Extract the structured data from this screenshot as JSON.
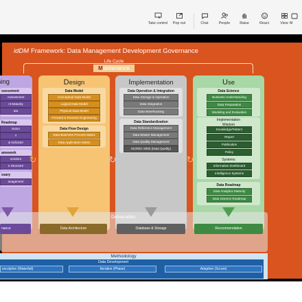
{
  "toolbar": {
    "buttons": [
      {
        "label": "Take control",
        "icon": "take-control-icon"
      },
      {
        "label": "Pop out",
        "icon": "pop-out-icon"
      },
      {
        "label": "Chat",
        "icon": "chat-icon"
      },
      {
        "label": "People",
        "icon": "people-icon"
      },
      {
        "label": "Raise",
        "icon": "raise-hand-icon"
      },
      {
        "label": "React",
        "icon": "react-icon"
      },
      {
        "label": "View",
        "icon": "view-icon"
      },
      {
        "label": "M",
        "icon": "more-icon"
      }
    ]
  },
  "slide": {
    "brand": "idDM",
    "title": "Framework: Data Management Development Governance",
    "lifecycle": "Life Cycle",
    "maintenance_cap": "M",
    "maintenance_rest": "aintenance",
    "columns": {
      "planning": {
        "title_rest": "ning",
        "boxes": [
          "ssessment",
          "Assessment",
          "nt Maturity",
          "ata",
          "Roadmap",
          "ission",
          "Y",
          "& Indicator",
          "amework",
          "ocedure",
          "e Structure",
          "ssary",
          "anagement"
        ]
      },
      "design": {
        "title_cap": "D",
        "title_rest": "esign",
        "model_heading": "Data Model",
        "model_boxes": [
          "Conceptual Data Model",
          "Logical Data Model",
          "Physical Data Model",
          "Forward & Reverse Engineering"
        ],
        "flow_heading": "Data Flow Design",
        "flow_boxes": [
          "Data Business Process Matrix",
          "Data Application Matrix"
        ]
      },
      "implementation": {
        "title_cap": "I",
        "title_rest": "mplementation",
        "ops_heading": "Data Operation & Integration",
        "ops_boxes": [
          "Data Storage & Operation",
          "Data Integration",
          "Data Warehousing"
        ],
        "std_heading": "Data Standardization",
        "std_boxes": [
          "Data Reference Management",
          "Data Master Management",
          "Data Quality Management",
          "ISO/IEC 8000 (Data Quality)"
        ]
      },
      "use": {
        "title_cap": "U",
        "title_rest": "se",
        "science_heading": "Data Science",
        "science_boxes": [
          "Business Understanding",
          "Data Preparation",
          "Modeling and Evaluation"
        ],
        "impl_heading": "Implementation",
        "wisdom_heading": "Wisdom",
        "wisdom_boxes": [
          "Knowledge/Pattern",
          "Report",
          "Publication",
          "Policy"
        ],
        "systems_heading": "Systems",
        "systems_boxes": [
          "Information Dashboard",
          "Intelligence Systems"
        ],
        "roadmap_heading": "Data Roadmap",
        "roadmap_boxes": [
          "Data Analytics Maturity",
          "Data Science Roadmap"
        ]
      }
    },
    "deliverables": {
      "label": "Deliverables",
      "items": [
        "nance",
        "Data Architecture",
        "Database & Storage",
        "Recommendation"
      ]
    },
    "methodology": {
      "label": "Methodology",
      "dev": "Data Development",
      "options": [
        "escriptive (Waterfall)",
        "Iterative (Phase)",
        "Adaptive (Scrum)"
      ]
    }
  },
  "colors": {
    "frame": "#d9541e",
    "planning": "#bda6e2",
    "design": "#f7c474",
    "implementation": "#c7c7c7",
    "use": "#a8d8a5",
    "methodology": "#1f5fa5"
  }
}
